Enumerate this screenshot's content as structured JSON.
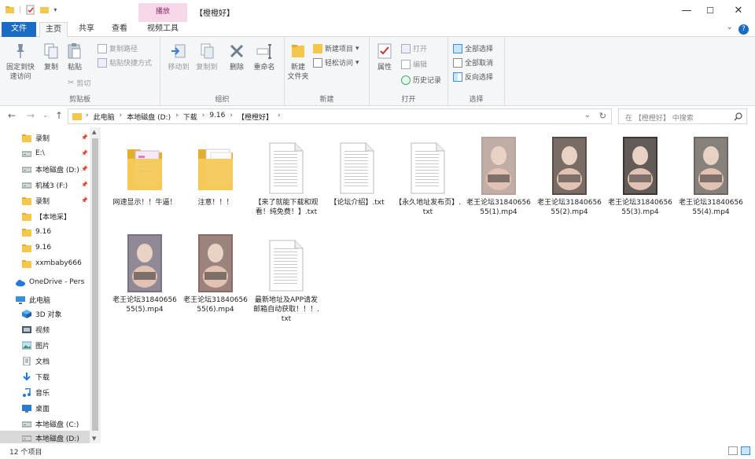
{
  "titlebar": {
    "context_tab": "播放",
    "title": "【橙橙好】",
    "controls": [
      "—",
      "☐",
      "✕"
    ]
  },
  "tabs": [
    "文件",
    "主页",
    "共享",
    "查看",
    "视频工具"
  ],
  "ribbon": {
    "clipboard": {
      "label": "剪贴板",
      "pin_quick_access": "固定到快\n速访问",
      "copy": "复制",
      "paste": "粘贴",
      "copy_path": "复制路径",
      "paste_shortcut": "粘贴快捷方式",
      "cut": "剪切"
    },
    "organize": {
      "label": "组织",
      "move_to": "移动到",
      "copy_to": "复制到",
      "delete": "删除",
      "rename": "重命名"
    },
    "new": {
      "label": "新建",
      "new_folder": "新建\n文件夹",
      "new_item": "新建项目",
      "easy_access": "轻松访问"
    },
    "open": {
      "label": "打开",
      "properties": "属性",
      "open": "打开",
      "edit": "编辑",
      "history": "历史记录"
    },
    "select": {
      "label": "选择",
      "select_all": "全部选择",
      "select_none": "全部取消",
      "invert": "反向选择"
    }
  },
  "address": {
    "crumbs": [
      "此电脑",
      "本地磁盘 (D:)",
      "下载",
      "9.16",
      "【橙橙好】"
    ],
    "search_placeholder": "在 【橙橙好】 中搜索"
  },
  "nav": [
    {
      "label": "录制",
      "icon": "folder-icon",
      "pinned": true
    },
    {
      "label": "E:\\",
      "icon": "drive-icon",
      "pinned": true
    },
    {
      "label": "本地磁盘 (D:)",
      "icon": "drive-icon",
      "pinned": true
    },
    {
      "label": "机械3 (F:)",
      "icon": "drive-icon",
      "pinned": true
    },
    {
      "label": "录制",
      "icon": "folder-icon",
      "pinned": true
    },
    {
      "label": "【本地采】",
      "icon": "folder-icon",
      "pinned": false
    },
    {
      "label": "9.16",
      "icon": "folder-icon",
      "pinned": false
    },
    {
      "label": "9.16",
      "icon": "folder-icon",
      "pinned": false
    },
    {
      "label": "xxmbaby666",
      "icon": "folder-icon",
      "pinned": false
    },
    {
      "label": "OneDrive - Pers",
      "icon": "cloud-icon",
      "pinned": false
    },
    {
      "label": "此电脑",
      "icon": "computer-icon",
      "pinned": false
    },
    {
      "label": "3D 对象",
      "icon": "cube-icon",
      "pinned": false
    },
    {
      "label": "视频",
      "icon": "video-icon",
      "pinned": false
    },
    {
      "label": "图片",
      "icon": "picture-icon",
      "pinned": false
    },
    {
      "label": "文档",
      "icon": "document-icon",
      "pinned": false
    },
    {
      "label": "下载",
      "icon": "download-icon",
      "pinned": false
    },
    {
      "label": "音乐",
      "icon": "music-icon",
      "pinned": false
    },
    {
      "label": "桌面",
      "icon": "desktop-icon",
      "pinned": false
    },
    {
      "label": "本地磁盘 (C:)",
      "icon": "drive-icon",
      "pinned": false
    },
    {
      "label": "本地磁盘 (D:)",
      "icon": "drive-icon",
      "pinned": false
    }
  ],
  "files": [
    {
      "name": "网速显示！！牛逼！",
      "type": "folder"
    },
    {
      "name": "注意！！！",
      "type": "folder"
    },
    {
      "name": "【来了就能下载和观看！纯免费！】.txt",
      "type": "txt"
    },
    {
      "name": "【论坛介绍】.txt",
      "type": "txt"
    },
    {
      "name": "【永久地址发布页】.txt",
      "type": "txt"
    },
    {
      "name": "老王论坛3184065655(1).mp4",
      "type": "video"
    },
    {
      "name": "老王论坛3184065655(2).mp4",
      "type": "video"
    },
    {
      "name": "老王论坛3184065655(3).mp4",
      "type": "video"
    },
    {
      "name": "老王论坛3184065655(4).mp4",
      "type": "video"
    },
    {
      "name": "老王论坛3184065655(5).mp4",
      "type": "video"
    },
    {
      "name": "老王论坛3184065655(6).mp4",
      "type": "video"
    },
    {
      "name": "最新地址及APP请发邮箱自动获取！！！.txt",
      "type": "txt"
    }
  ],
  "status": "12 个项目",
  "colors": {
    "accent": "#1a6bc4",
    "folder": "#f3c64c",
    "context_tab": "#f6d8ea"
  }
}
